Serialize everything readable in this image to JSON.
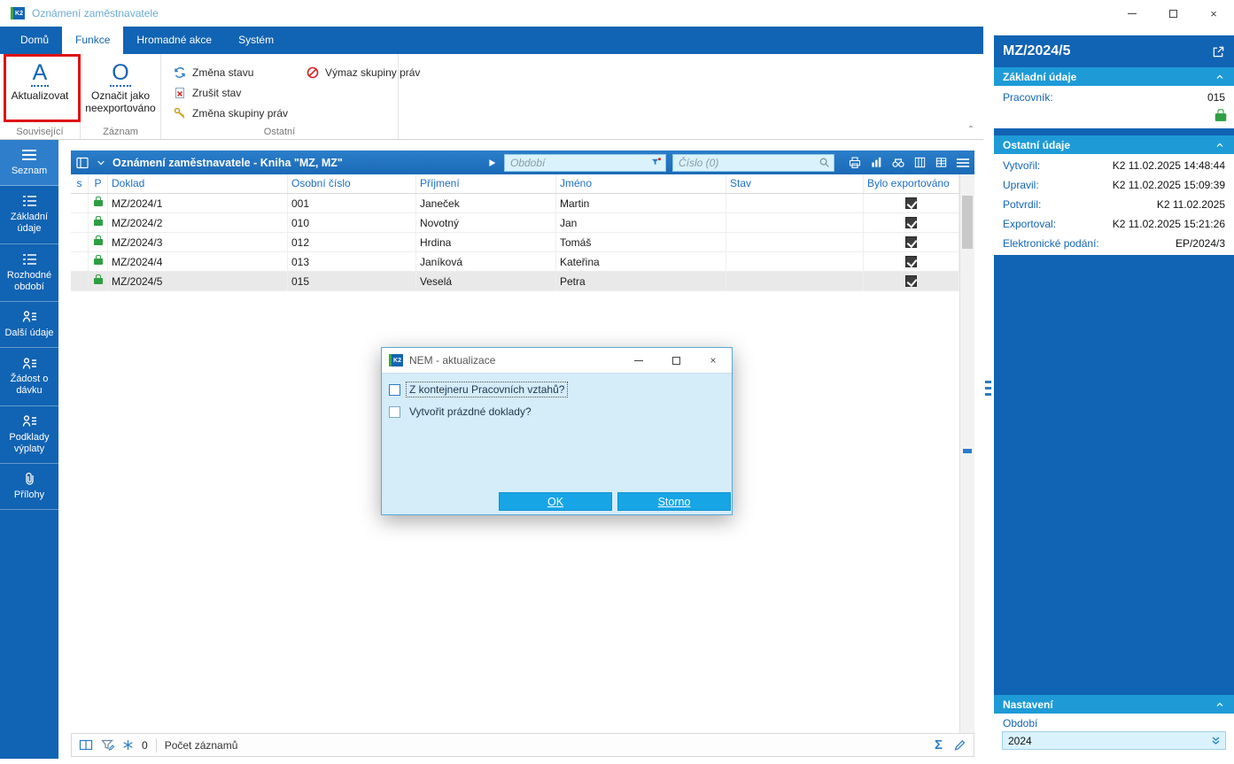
{
  "colors": {
    "primary_blue": "#1163b3",
    "section_header_blue": "#1e9bd7",
    "grid_titlebar_blue": "#1b6ab8",
    "input_bg": "#d9f2fc",
    "highlight_red": "#e01212",
    "lock_green": "#2f9e42"
  },
  "window": {
    "title": "Oznámení zaměstnavatele"
  },
  "tabs": [
    {
      "label": "Domů"
    },
    {
      "label": "Funkce"
    },
    {
      "label": "Hromadné akce"
    },
    {
      "label": "Systém"
    }
  ],
  "ribbon": {
    "aktualizovat": {
      "label": "Aktualizovat",
      "icon_letter": "A"
    },
    "oznacit": {
      "label": "Označit jako neexportováno",
      "icon_letter": "O"
    },
    "zmena_stavu": "Změna stavu",
    "zrusit_stav": "Zrušit stav",
    "zmena_skupiny": "Změna skupiny práv",
    "vymaz_skupiny": "Výmaz skupiny práv",
    "groups": {
      "souvisejici": "Související",
      "zaznam": "Záznam",
      "ostatni": "Ostatní"
    }
  },
  "sidebar": {
    "items": [
      {
        "label": "Seznam",
        "icon": "menu-icon",
        "active": true
      },
      {
        "label": "Základní údaje",
        "icon": "list-icon",
        "active": false
      },
      {
        "label": "Rozhodné období",
        "icon": "list-icon",
        "active": false
      },
      {
        "label": "Další údaje",
        "icon": "person-list-icon",
        "active": false
      },
      {
        "label": "Žádost o dávku",
        "icon": "person-list-icon",
        "active": false
      },
      {
        "label": "Podklady výplaty",
        "icon": "person-list-icon",
        "active": false
      },
      {
        "label": "Přílohy",
        "icon": "paperclip-icon",
        "active": false
      }
    ]
  },
  "grid": {
    "title": "Oznámení zaměstnavatele - Kniha \"MZ, MZ\"",
    "filters": {
      "obdobi": "Období",
      "cislo": "Číslo (0)"
    },
    "columns": [
      "s",
      "P",
      "Doklad",
      "Osobní číslo",
      "Příjmení",
      "Jméno",
      "Stav",
      "Bylo exportováno"
    ],
    "rows": [
      {
        "doklad": "MZ/2024/1",
        "osobni": "001",
        "prijmeni": "Janeček",
        "jmeno": "Martin",
        "stav": "",
        "exportovano": true,
        "selected": false
      },
      {
        "doklad": "MZ/2024/2",
        "osobni": "010",
        "prijmeni": "Novotný",
        "jmeno": "Jan",
        "stav": "",
        "exportovano": true,
        "selected": false
      },
      {
        "doklad": "MZ/2024/3",
        "osobni": "012",
        "prijmeni": "Hrdina",
        "jmeno": "Tomáš",
        "stav": "",
        "exportovano": true,
        "selected": false
      },
      {
        "doklad": "MZ/2024/4",
        "osobni": "013",
        "prijmeni": "Janíková",
        "jmeno": "Kateřina",
        "stav": "",
        "exportovano": true,
        "selected": false
      },
      {
        "doklad": "MZ/2024/5",
        "osobni": "015",
        "prijmeni": "Veselá",
        "jmeno": "Petra",
        "stav": "",
        "exportovano": true,
        "selected": true
      }
    ]
  },
  "statusbar": {
    "filter_count": "0",
    "count_label": "Počet záznamů"
  },
  "panel": {
    "title": "MZ/2024/5",
    "zakladni": {
      "header": "Základní údaje",
      "pracovnik_label": "Pracovník:",
      "pracovnik_value": "015"
    },
    "ostatni": {
      "header": "Ostatní údaje",
      "rows": [
        {
          "label": "Vytvořil:",
          "value": "K2 11.02.2025 14:48:44"
        },
        {
          "label": "Upravil:",
          "value": "K2 11.02.2025 15:09:39"
        },
        {
          "label": "Potvrdil:",
          "value": "K2 11.02.2025"
        },
        {
          "label": "Exportoval:",
          "value": "K2 11.02.2025 15:21:26"
        },
        {
          "label": "Elektronické podání:",
          "value": "EP/2024/3"
        }
      ]
    },
    "nastaveni": {
      "header": "Nastavení",
      "obdobi_label": "Období",
      "obdobi_value": "2024"
    }
  },
  "dialog": {
    "title": "NEM - aktualizace",
    "checkbox1": "Z kontejneru Pracovních vztahů?",
    "checkbox2": "Vytvořit prázdné doklady?",
    "ok": "OK",
    "storno": "Storno"
  }
}
